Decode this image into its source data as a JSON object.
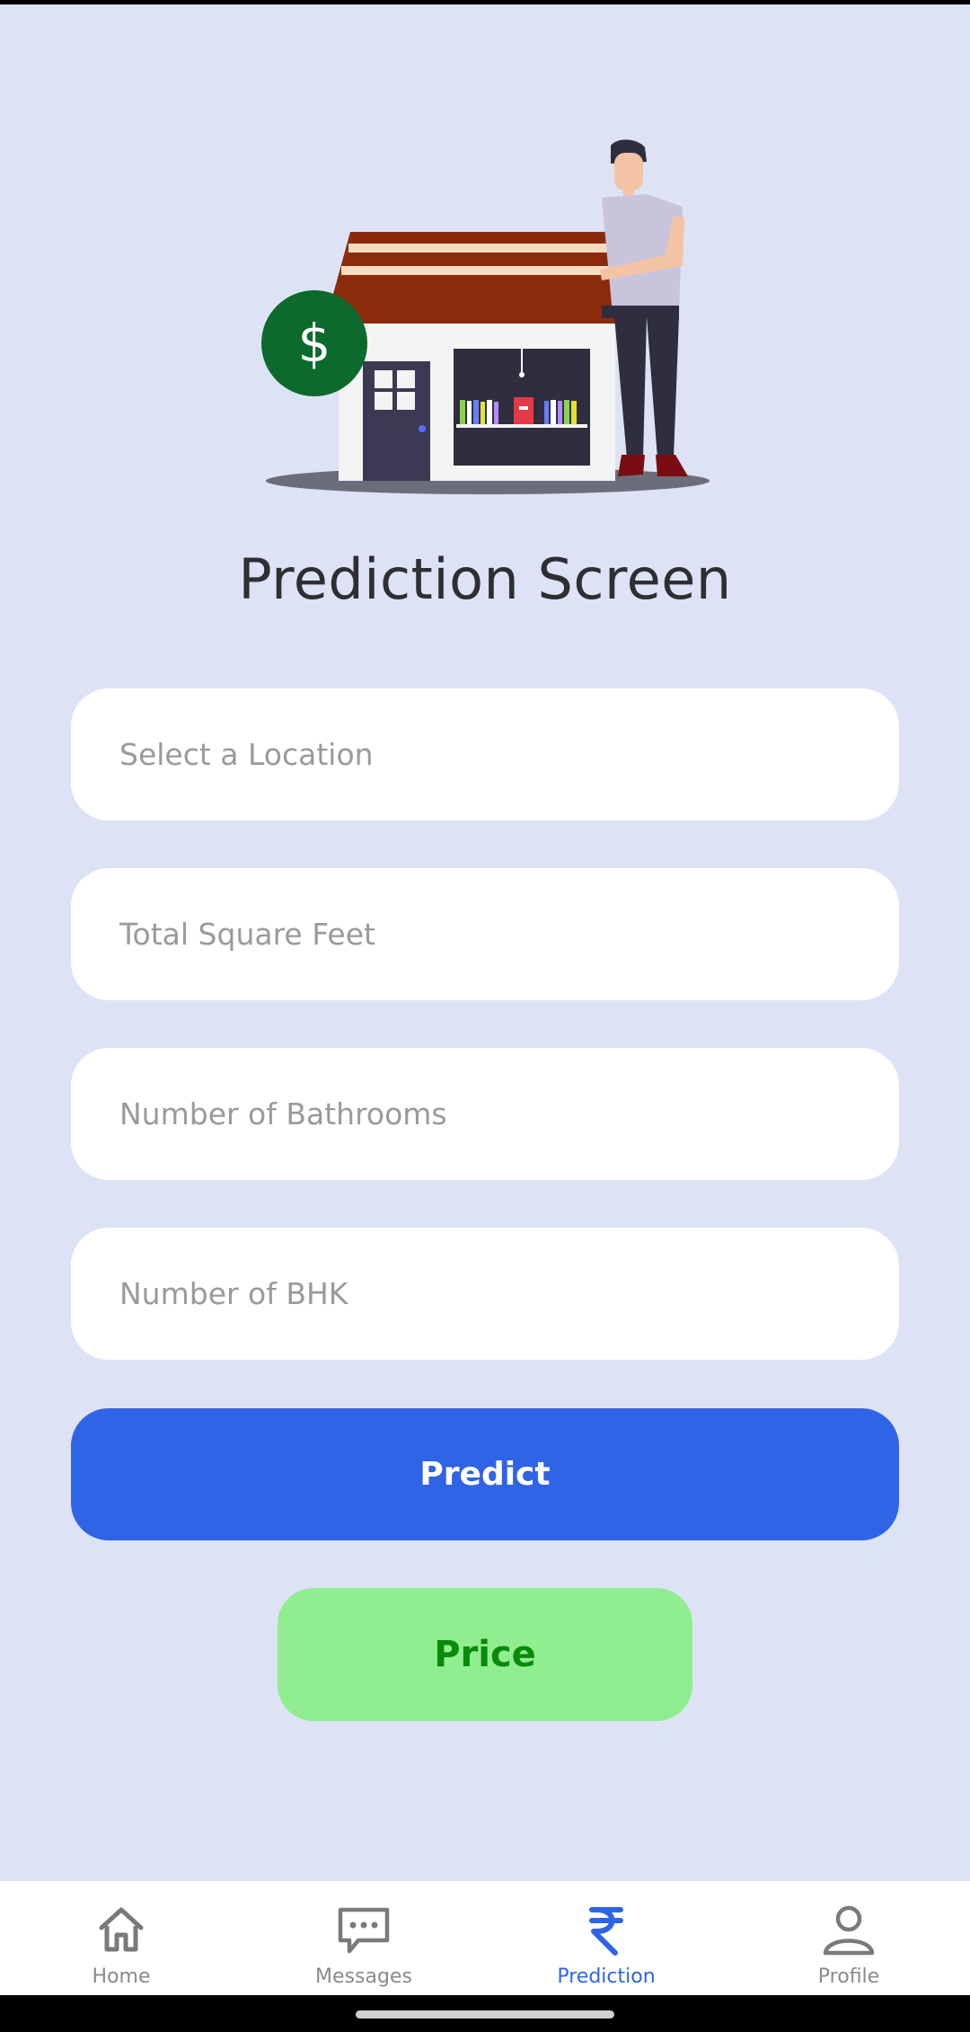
{
  "title": "Prediction Screen",
  "form": {
    "location_placeholder": "Select a Location",
    "sqft_placeholder": "Total Square Feet",
    "bathrooms_placeholder": "Number of Bathrooms",
    "bhk_placeholder": "Number of BHK"
  },
  "buttons": {
    "predict_label": "Predict",
    "price_label": "Price"
  },
  "nav": {
    "items": [
      {
        "label": "Home",
        "icon": "home-icon"
      },
      {
        "label": "Messages",
        "icon": "messages-icon"
      },
      {
        "label": "Prediction",
        "icon": "rupee-icon",
        "active": true
      },
      {
        "label": "Profile",
        "icon": "profile-icon"
      }
    ]
  },
  "hero": {
    "coin_symbol": "$"
  },
  "colors": {
    "background": "#dde3f5",
    "primary": "#3064e6",
    "price_bg": "#90ee90",
    "price_text": "#0a8a0a"
  }
}
